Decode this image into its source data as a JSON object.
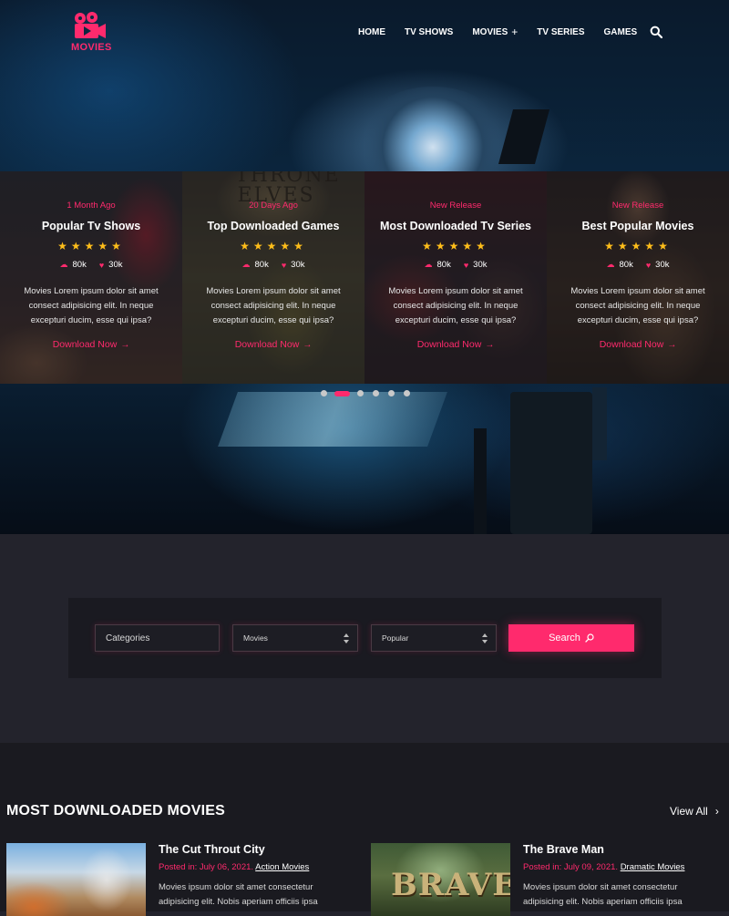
{
  "brand": {
    "logo_text": "MOVIES",
    "accent": "#ff2a6d"
  },
  "nav": {
    "items": [
      {
        "label": "HOME"
      },
      {
        "label": "TV SHOWS"
      },
      {
        "label": "MOVIES",
        "has_submenu": true,
        "submenu_icon": "+"
      },
      {
        "label": "TV SERIES"
      },
      {
        "label": "GAMES"
      }
    ],
    "search_icon": "search-icon"
  },
  "carousel": {
    "cards": [
      {
        "tag": "1 Month Ago",
        "title": "Popular Tv Shows",
        "stars": "★★★★★",
        "downloads": "80k",
        "likes": "30k",
        "description": "Movies Lorem ipsum dolor sit amet consect adipisicing elit. In neque excepturi ducim, esse qui ipsa?",
        "link": "Download Now"
      },
      {
        "tag": "20 Days Ago",
        "title": "Top Downloaded Games",
        "stars": "★★★★★",
        "downloads": "80k",
        "likes": "30k",
        "description": "Movies Lorem ipsum dolor sit amet consect adipisicing elit. In neque excepturi ducim, esse qui ipsa?",
        "link": "Download Now"
      },
      {
        "tag": "New Release",
        "title": "Most Downloaded Tv Series",
        "stars": "★★★★★",
        "downloads": "80k",
        "likes": "30k",
        "description": "Movies Lorem ipsum dolor sit amet consect adipisicing elit. In neque excepturi ducim, esse qui ipsa?",
        "link": "Download Now"
      },
      {
        "tag": "New Release",
        "title": "Best Popular Movies",
        "stars": "★★★★★",
        "downloads": "80k",
        "likes": "30k",
        "description": "Movies Lorem ipsum dolor sit amet consect adipisicing elit. In neque excepturi ducim, esse qui ipsa?",
        "link": "Download Now"
      }
    ],
    "dots_count": 6,
    "active_dot": 2,
    "card_backdrop_text": "THRONE ELVES"
  },
  "search": {
    "categories_placeholder": "Categories",
    "type_value": "Movies",
    "sort_value": "Popular",
    "button_label": "Search"
  },
  "section": {
    "title": "MOST DOWNLOADED MOVIES",
    "view_all": "View All",
    "movies": [
      {
        "title": "The Cut Throut City",
        "posted": "Posted in: July 06, 2021.",
        "genre": "Action Movies",
        "description": "Movies ipsum dolor sit amet consectetur adipisicing elit. Nobis aperiam officiis ipsa"
      },
      {
        "title": "The Brave Man",
        "posted": "Posted in: July 09, 2021.",
        "genre": "Dramatic Movies",
        "description": "Movies ipsum dolor sit amet consectetur adipisicing elit. Nobis aperiam officiis ipsa"
      }
    ],
    "poster_text_2": "BRAVE"
  }
}
